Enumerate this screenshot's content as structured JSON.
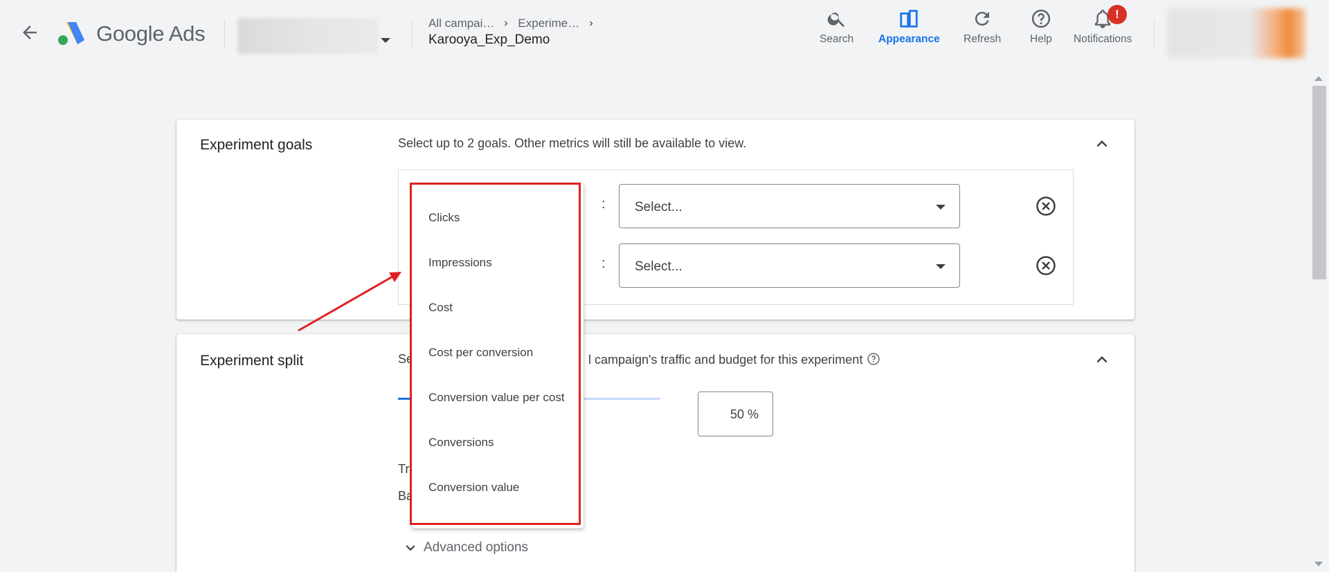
{
  "header": {
    "brand_google": "Google",
    "brand_ads": "Ads",
    "breadcrumbs": [
      "All campai…",
      "Experime…"
    ],
    "campaign_name": "Karooya_Exp_Demo",
    "tools": {
      "search": "Search",
      "appearance": "Appearance",
      "refresh": "Refresh",
      "help": "Help",
      "notifications": "Notifications"
    },
    "notification_badge": "!"
  },
  "goals_card": {
    "title": "Experiment goals",
    "description": "Select up to 2 goals. Other metrics will still be available to view.",
    "rows": [
      {
        "colon": ":",
        "select_value": "Select..."
      },
      {
        "colon": ":",
        "select_value": "Select..."
      }
    ]
  },
  "split_card": {
    "title": "Experiment split",
    "description_start": "Se",
    "description_end": "l campaign's traffic and budget for this experiment",
    "percent": "50",
    "percent_unit": "%",
    "label_1": "Tr",
    "label_2": "Ba",
    "advanced_options": "Advanced options"
  },
  "goal_menu": {
    "items": [
      "Clicks",
      "Impressions",
      "Cost",
      "Cost per conversion",
      "Conversion value per cost",
      "Conversions",
      "Conversion value"
    ]
  },
  "colors": {
    "accent": "#1a73e8",
    "annotation_red": "#e02020",
    "badge_red": "#d93025"
  }
}
